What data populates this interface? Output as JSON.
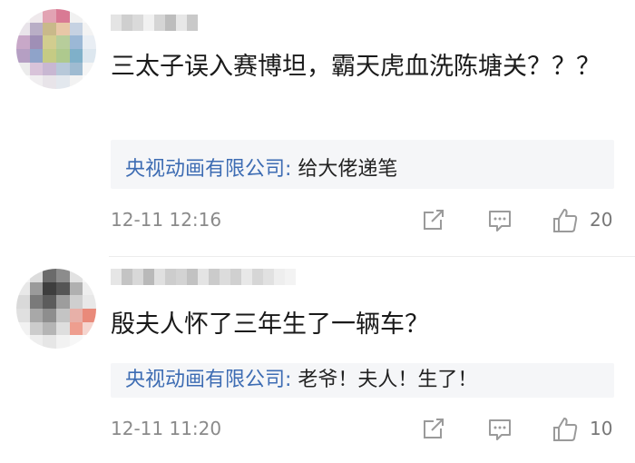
{
  "comments": [
    {
      "content": "三太子误入赛博坦，霸天虎血洗陈塘关？？？",
      "reply": {
        "name": "央视动画有限公司:",
        "text": " 给大佬递笔"
      },
      "time": "12-11 12:16",
      "likes": "20"
    },
    {
      "content": "殷夫人怀了三年生了一辆车？",
      "reply": {
        "name": "央视动画有限公司:",
        "text": " 老爷！夫人！生了！"
      },
      "time": "12-11 11:20",
      "likes": "10"
    }
  ],
  "colors": {
    "reply_name": "#3d6cb3",
    "reply_bg": "#f5f6f8",
    "meta_text": "#8a8a8a",
    "icon": "#9a9a9a"
  },
  "icons": [
    "share-icon",
    "comment-icon",
    "like-icon"
  ]
}
